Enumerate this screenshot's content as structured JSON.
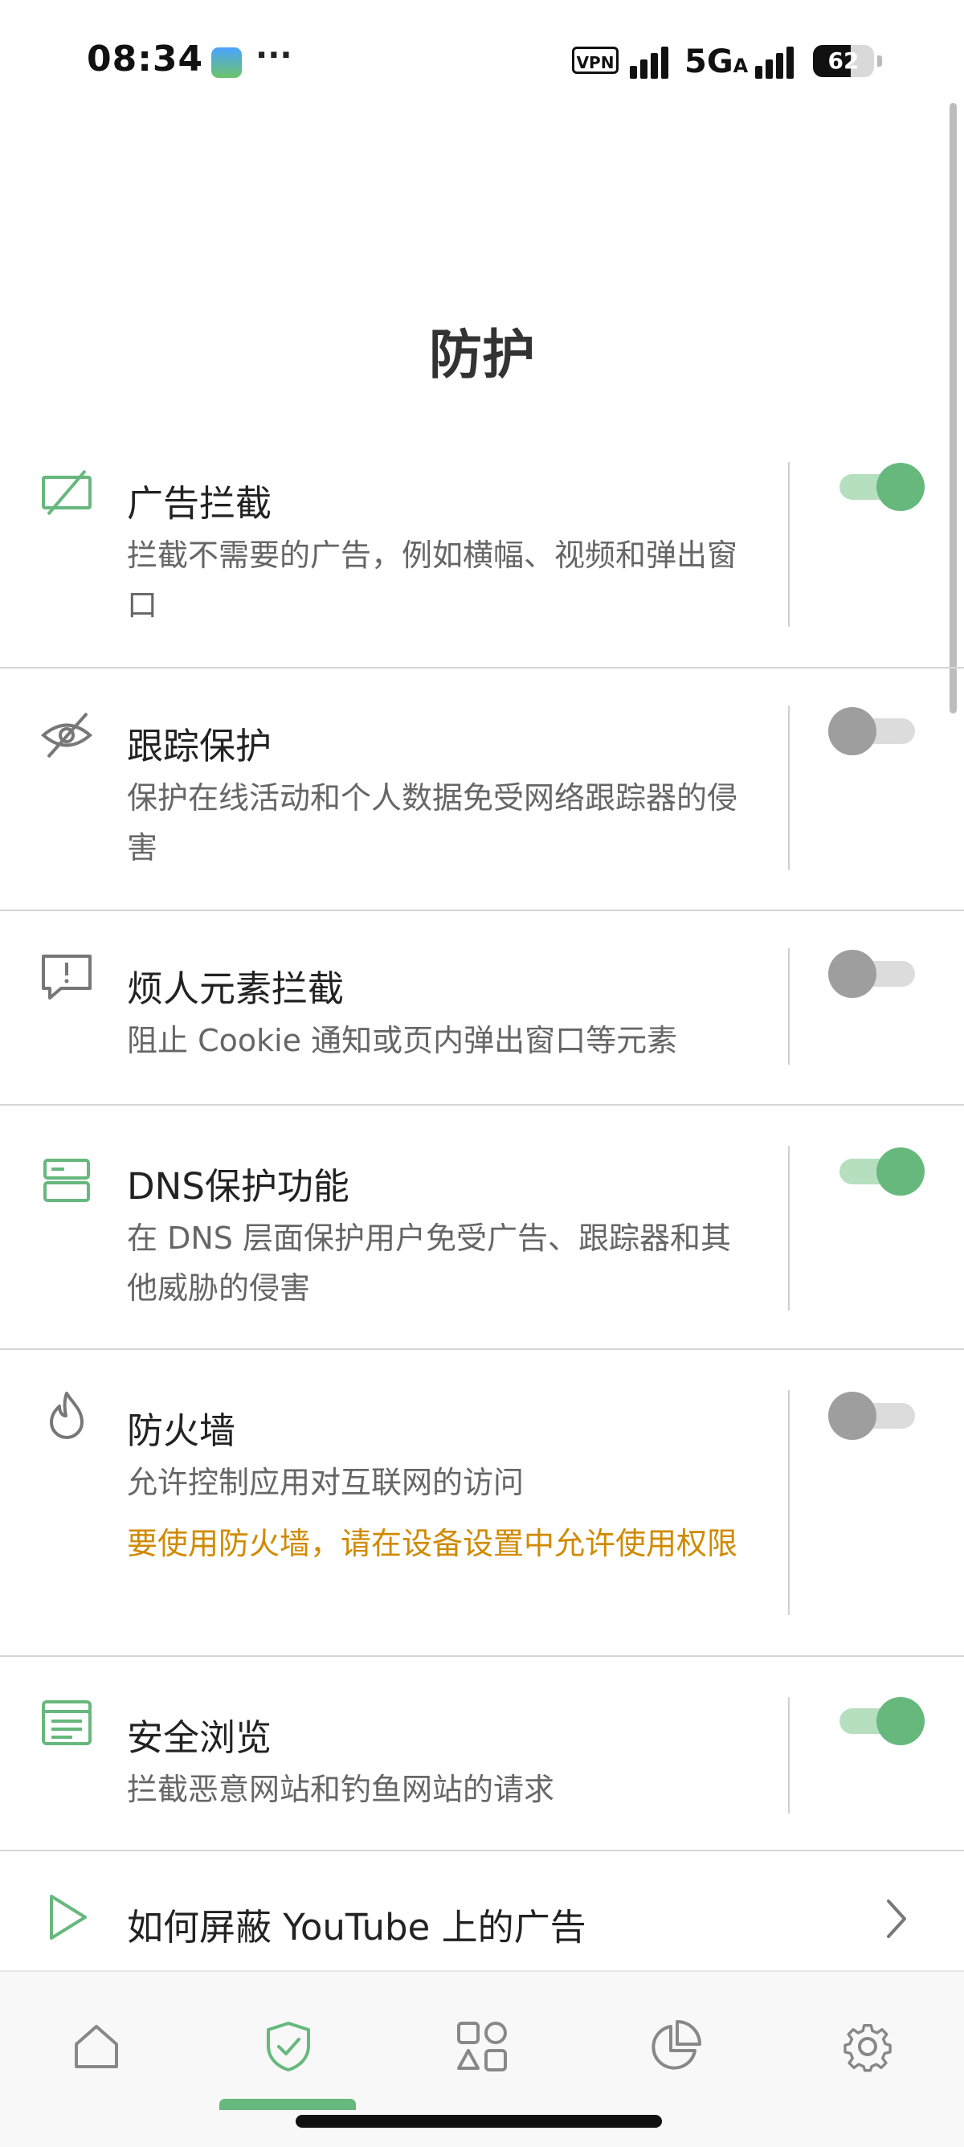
{
  "status_bar": {
    "time": "08:34",
    "more": "···",
    "vpn_label": "VPN",
    "network": "5G",
    "network_sub": "A",
    "battery": "62",
    "battery_level": 0.62
  },
  "page": {
    "title": "防护"
  },
  "colors": {
    "accent": "#67b87d",
    "warning": "#d08a00"
  },
  "items": [
    {
      "icon": "ad-block-icon",
      "title": "广告拦截",
      "desc": "拦截不需要的广告，例如横幅、视频和弹出窗口",
      "enabled": true
    },
    {
      "icon": "eye-off-icon",
      "title": "跟踪保护",
      "desc": "保护在线活动和个人数据免受网络跟踪器的侵害",
      "enabled": false
    },
    {
      "icon": "alert-message-icon",
      "title": "烦人元素拦截",
      "desc": "阻止 Cookie 通知或页内弹出窗口等元素",
      "enabled": false
    },
    {
      "icon": "dns-server-icon",
      "title": "DNS保护功能",
      "desc": "在 DNS 层面保护用户免受广告、跟踪器和其他威胁的侵害",
      "enabled": true
    },
    {
      "icon": "flame-icon",
      "title": "防火墙",
      "desc": "允许控制应用对互联网的访问",
      "warning": "要使用防火墙，请在设备设置中允许使用权限",
      "enabled": false
    },
    {
      "icon": "browser-window-icon",
      "title": "安全浏览",
      "desc": "拦截恶意网站和钓鱼网站的请求",
      "enabled": true
    }
  ],
  "youtube_link": {
    "icon": "play-icon",
    "title": "如何屏蔽 YouTube 上的广告"
  },
  "bottom_nav": [
    {
      "name": "home-icon",
      "active": false
    },
    {
      "name": "shield-check-icon",
      "active": true
    },
    {
      "name": "apps-grid-icon",
      "active": false
    },
    {
      "name": "pie-chart-icon",
      "active": false
    },
    {
      "name": "gear-icon",
      "active": false
    }
  ]
}
